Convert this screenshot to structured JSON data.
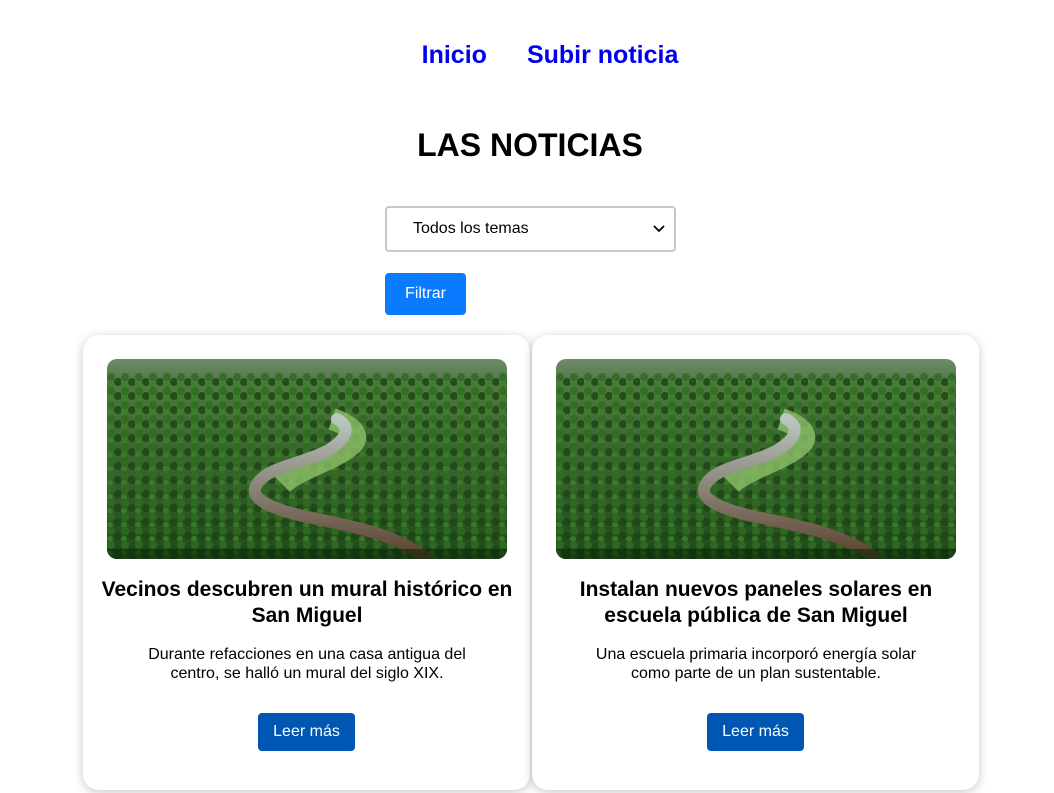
{
  "nav": {
    "links": [
      "Inicio",
      "Subir noticia"
    ]
  },
  "page": {
    "title": "LAS NOTICIAS"
  },
  "filter": {
    "selected": "Todos los temas",
    "button_label": "Filtrar"
  },
  "cards": [
    {
      "title": "Vecinos descubren un mural histórico en San Miguel",
      "description": "Durante refacciones en una casa antigua del centro, se halló un mural del siglo XIX.",
      "button_label": "Leer más",
      "image": "aerial-forest-river"
    },
    {
      "title": "Instalan nuevos paneles solares en escuela pública de San Miguel",
      "description": "Una escuela primaria incorporó energía solar como parte de un plan sustentable.",
      "button_label": "Leer más",
      "image": "aerial-forest-river"
    }
  ],
  "colors": {
    "link": "#0000ee",
    "filter_button": "#0a7bff",
    "read_more_button": "#0056b3"
  }
}
